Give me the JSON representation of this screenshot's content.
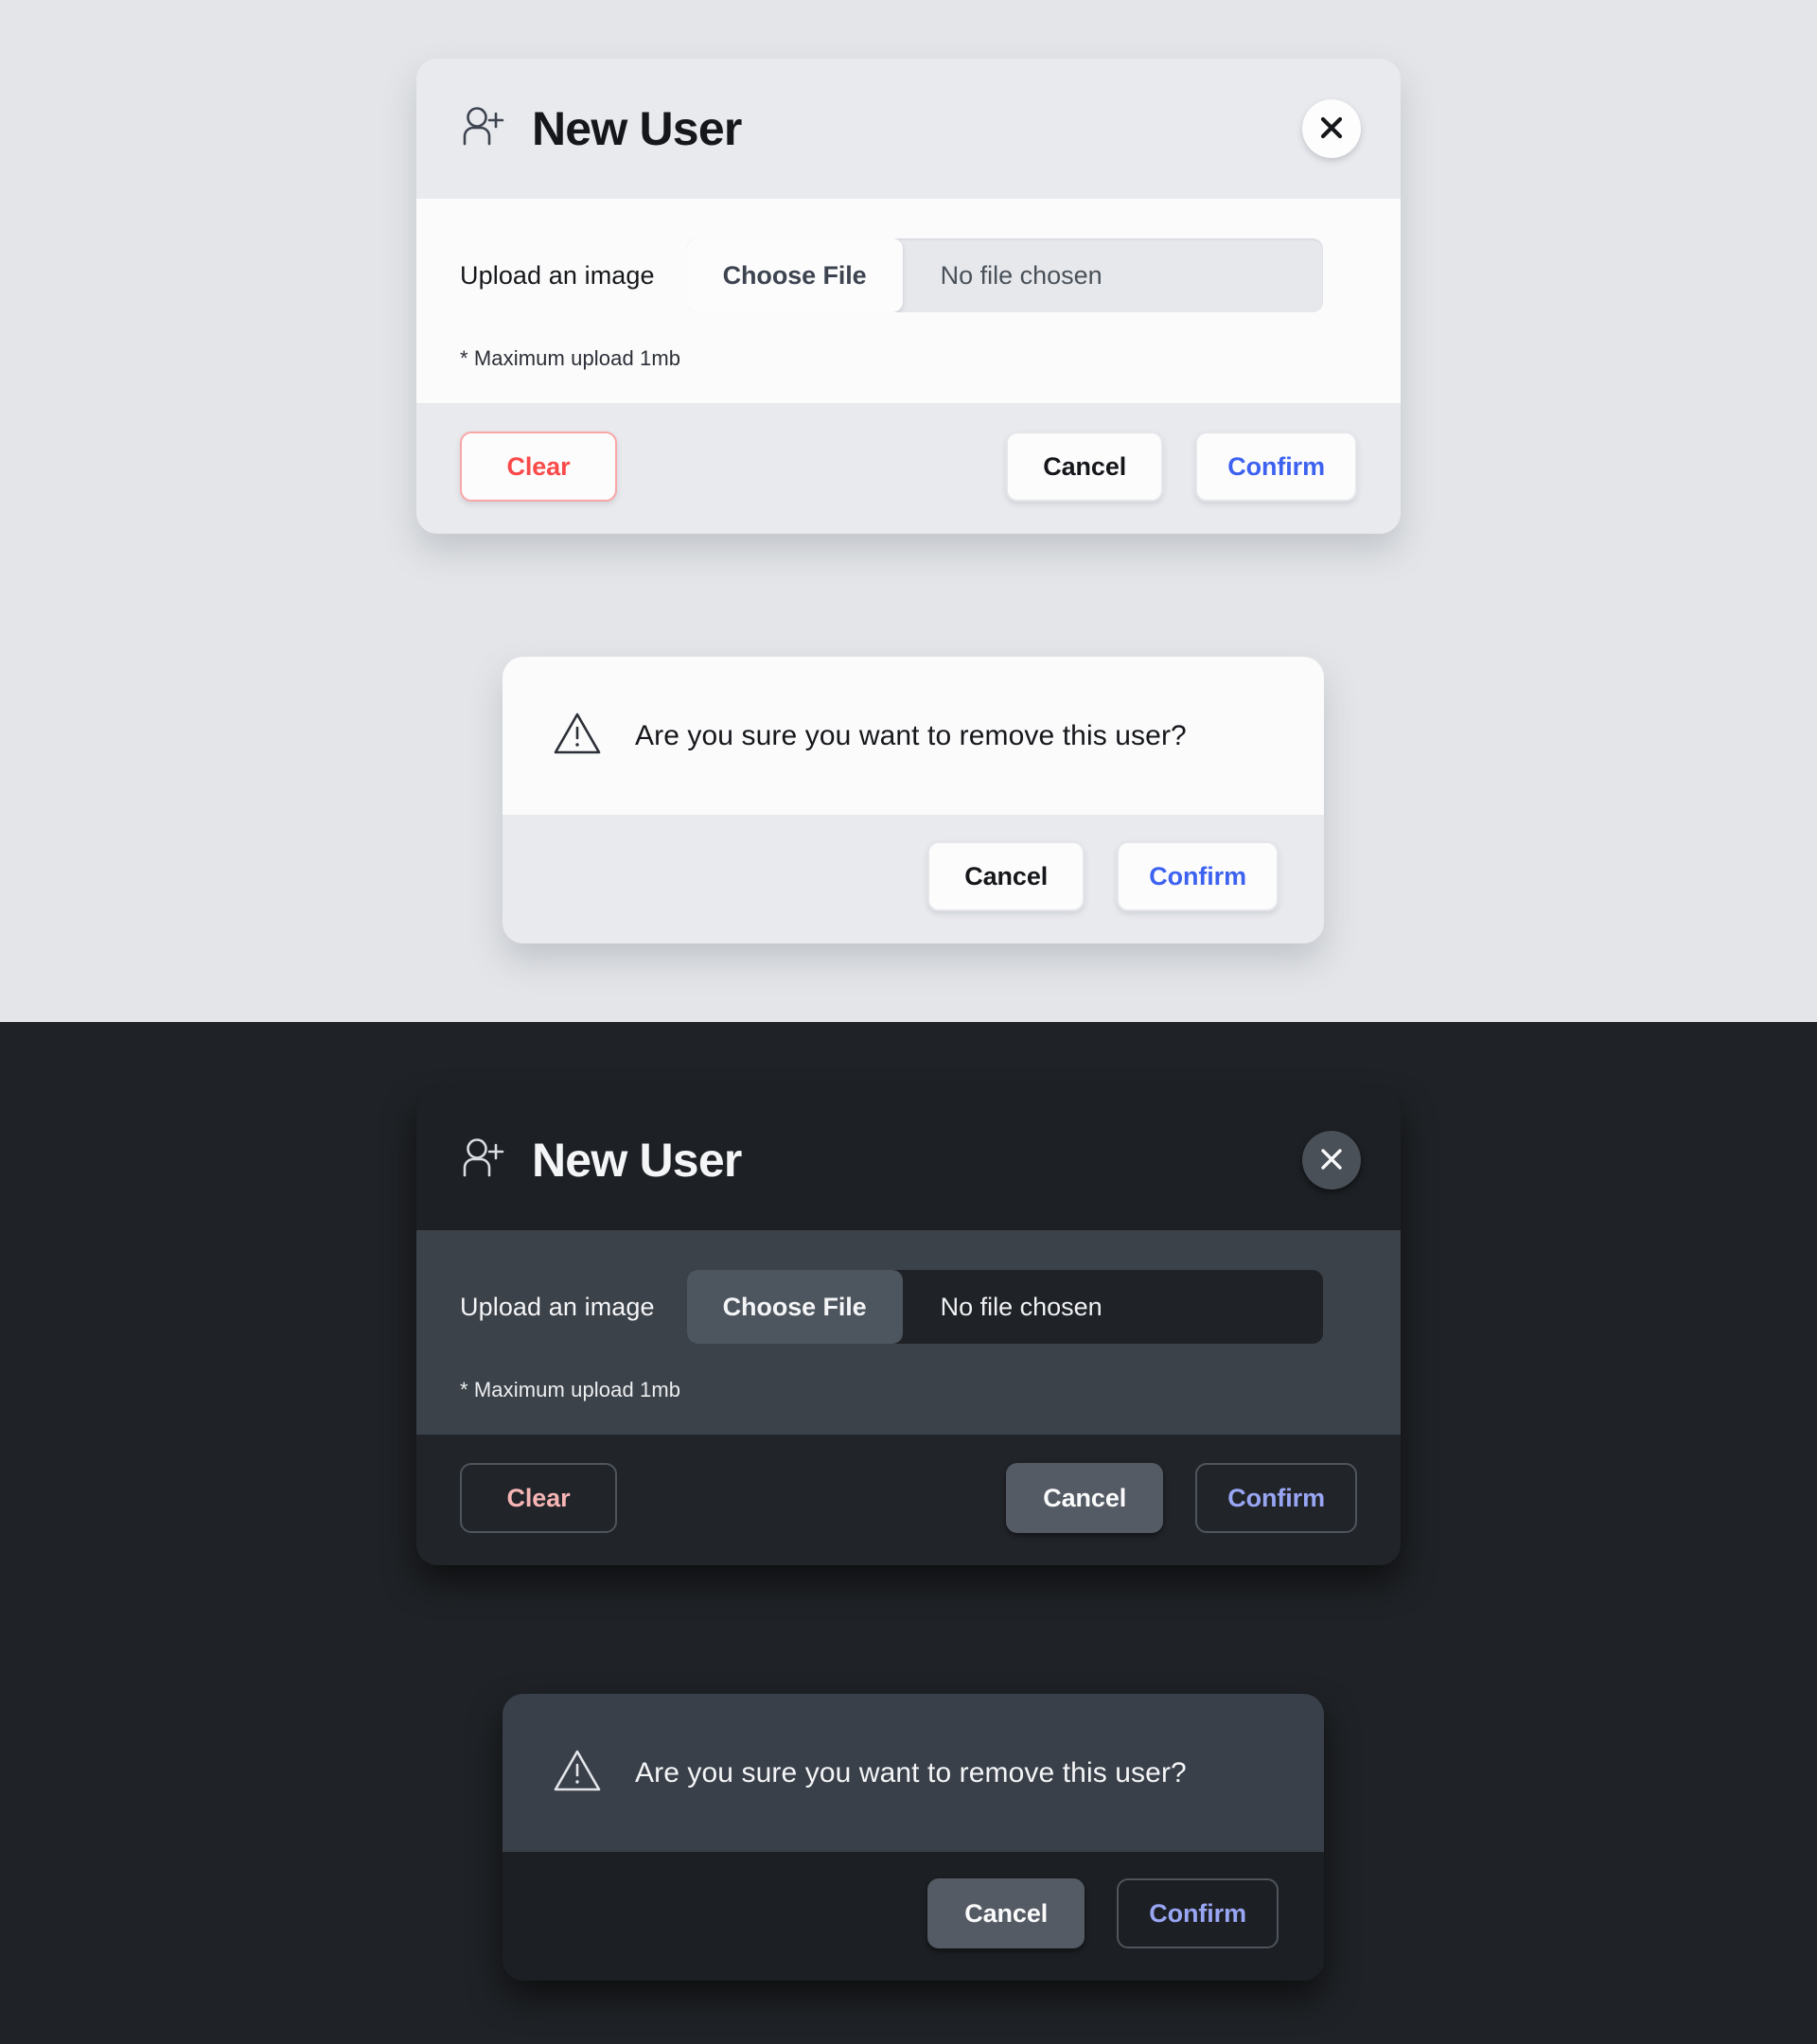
{
  "page": {
    "light_background": "#e3e5e8",
    "dark_background": "#1f2226"
  },
  "new_user_modal": {
    "icon": "person-add-icon",
    "title": "New User",
    "close_label": "✕",
    "upload_label": "Upload an image",
    "choose_file_label": "Choose File",
    "file_name_value": "No file chosen",
    "max_note": "* Maximum upload 1mb",
    "buttons": {
      "clear": "Clear",
      "cancel": "Cancel",
      "confirm": "Confirm"
    },
    "colors": {
      "clear_light": "#fa4a4a",
      "confirm_light": "#3d62f0",
      "clear_dark": "#f6b5b5",
      "confirm_dark": "#99a6f4"
    }
  },
  "confirm_dialog": {
    "icon": "warning-triangle-icon",
    "message": "Are you sure you want to remove this user?",
    "buttons": {
      "cancel": "Cancel",
      "confirm": "Confirm"
    }
  }
}
